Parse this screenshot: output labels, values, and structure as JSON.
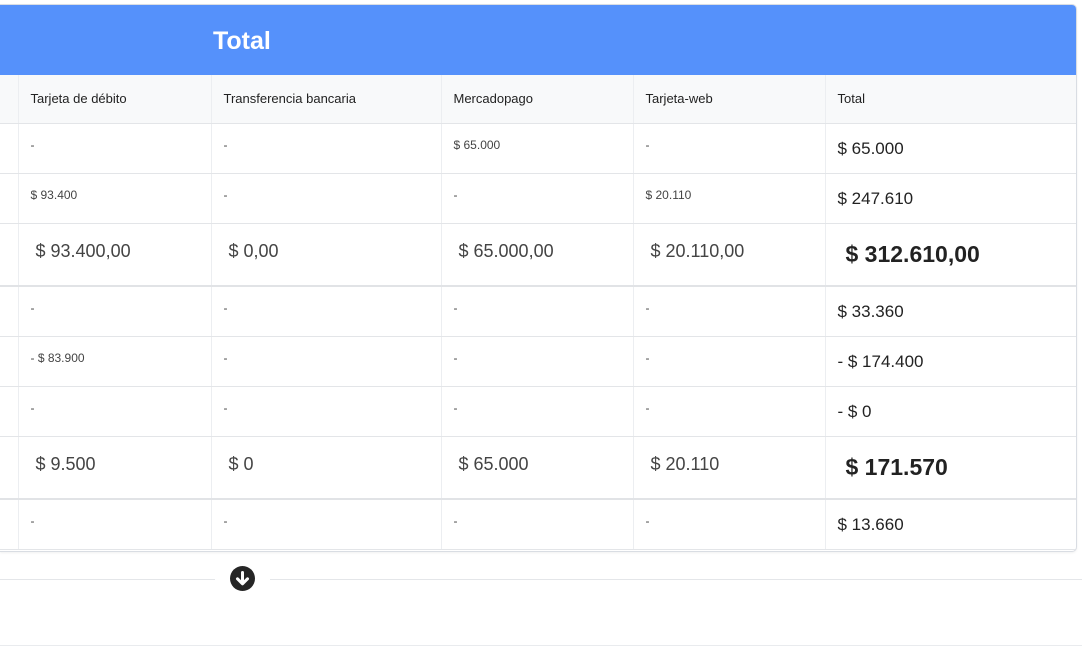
{
  "card": {
    "title": "Total"
  },
  "table": {
    "headers": [
      "",
      "Tarjeta de débito",
      "Transferencia bancaria",
      "Mercadopago",
      "Tarjeta-web",
      "Total"
    ],
    "rows": [
      {
        "type": "small",
        "cells": [
          "",
          "-",
          "-",
          "$ 65.000",
          "-",
          "$ 65.000"
        ]
      },
      {
        "type": "small",
        "cells": [
          "",
          "$ 93.400",
          "-",
          "-",
          "$ 20.110",
          "$ 247.610"
        ]
      },
      {
        "type": "sum",
        "cells": [
          "",
          "$ 93.400,00",
          "$ 0,00",
          "$ 65.000,00",
          "$ 20.110,00",
          "$ 312.610,00"
        ]
      },
      {
        "type": "small",
        "cells": [
          "",
          "-",
          "-",
          "-",
          "-",
          "$ 33.360"
        ]
      },
      {
        "type": "small",
        "cells": [
          "",
          "- $ 83.900",
          "-",
          "-",
          "-",
          "- $ 174.400"
        ]
      },
      {
        "type": "small",
        "cells": [
          "",
          "-",
          "-",
          "-",
          "-",
          "- $ 0"
        ]
      },
      {
        "type": "sum",
        "cells": [
          "",
          "$ 9.500",
          "$ 0",
          "$ 65.000",
          "$ 20.110",
          "$ 171.570"
        ]
      },
      {
        "type": "small",
        "cells": [
          "",
          "-",
          "-",
          "-",
          "-",
          "$ 13.660"
        ]
      }
    ]
  },
  "controls": {
    "scroll_down_icon": "arrow-down-circle-icon"
  }
}
